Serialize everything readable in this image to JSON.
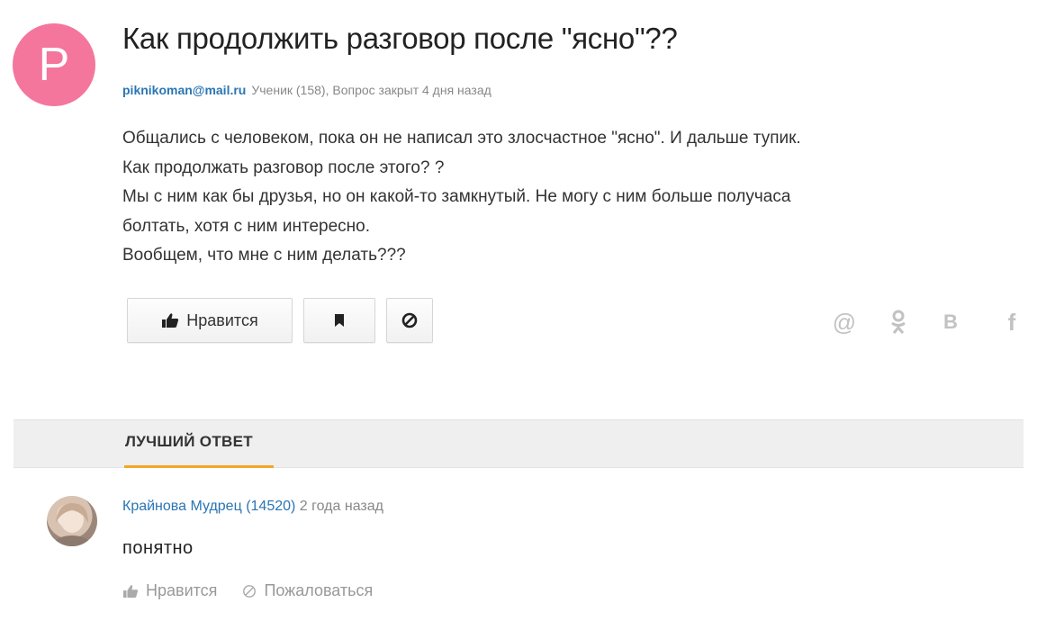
{
  "question": {
    "avatar_letter": "P",
    "title": "Как продолжить разговор после \"ясно\"??",
    "author": "piknikoman@mail.ru",
    "status": "Ученик (158), Вопрос закрыт 4 дня назад",
    "body_lines": [
      "Общались с человеком, пока он не написал это злосчастное \"ясно\". И дальше тупик.",
      "Как продолжать разговор после этого? ?",
      "Мы с ним как бы друзья, но он какой-то замкнутый. Не могу с ним больше получаса",
      "болтать, хотя с ним интересно.",
      "Вообщем, что мне с ним делать???"
    ]
  },
  "actions": {
    "like_label": "Нравится"
  },
  "share": {
    "mail": "@",
    "ok": "ꝏ",
    "vk": "B",
    "fb": "f"
  },
  "best_answer": {
    "heading": "ЛУЧШИЙ ОТВЕТ",
    "author_name": "Крайнова",
    "author_rank": "Мудрец (14520)",
    "time": "2 года назад",
    "text": "понятно",
    "like_label": "Нравится",
    "report_label": "Пожаловаться"
  },
  "colors": {
    "avatar_bg": "#f4769c",
    "link": "#2a75b4",
    "best_underline": "#f5a623"
  }
}
